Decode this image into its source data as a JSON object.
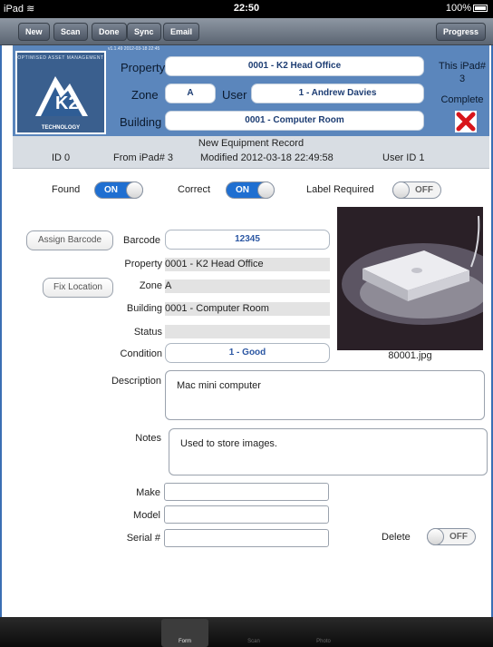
{
  "status_bar": {
    "device": "iPad",
    "time": "22:50",
    "battery": "100%"
  },
  "toolbar": {
    "buttons": [
      "New",
      "Scan",
      "Done",
      "Sync",
      "Email"
    ],
    "progress": "Progress"
  },
  "header": {
    "version": "v1.1.49 2012-03-18 22:45",
    "logo_top": "OPTIMISED ASSET MANAGEMENT",
    "logo_bottom": "TECHNOLOGY",
    "property_label": "Property",
    "property_value": "0001 - K2 Head Office",
    "zone_label": "Zone",
    "zone_value": "A",
    "user_label": "User",
    "user_value": "1 - Andrew Davies",
    "building_label": "Building",
    "building_value": "0001 - Computer Room",
    "this_ipad_label": "This iPad#",
    "this_ipad_value": "3",
    "complete_label": "Complete"
  },
  "info": {
    "title": "New Equipment Record",
    "id": "ID 0",
    "from_ipad": "From iPad# 3",
    "modified": "Modified  2012-03-18 22:49:58",
    "user_id": "User ID  1"
  },
  "toggles": {
    "found_label": "Found",
    "found_state": "ON",
    "correct_label": "Correct",
    "correct_state": "ON",
    "label_required_label": "Label Required",
    "label_required_state": "OFF",
    "delete_label": "Delete",
    "delete_state": "OFF"
  },
  "form": {
    "assign_barcode": "Assign Barcode",
    "fix_location": "Fix Location",
    "barcode_label": "Barcode",
    "barcode_value": "12345",
    "property_label": "Property",
    "property_value": "0001 - K2 Head Office",
    "zone_label": "Zone",
    "zone_value": "A",
    "building_label": "Building",
    "building_value": "0001 - Computer Room",
    "status_label": "Status",
    "status_value": "",
    "condition_label": "Condition",
    "condition_value": "1 - Good",
    "description_label": "Description",
    "description_value": "Mac mini computer",
    "notes_label": "Notes",
    "notes_value": "Used to store images.",
    "make_label": "Make",
    "model_label": "Model",
    "serial_label": "Serial #",
    "photo_caption": "80001.jpg"
  },
  "tabs": [
    "Form",
    "Scan",
    "Photo"
  ],
  "colors": {
    "header_bg": "#5b86bc",
    "toggle_on": "#1f6fd1",
    "delete_x": "#d8151b"
  }
}
